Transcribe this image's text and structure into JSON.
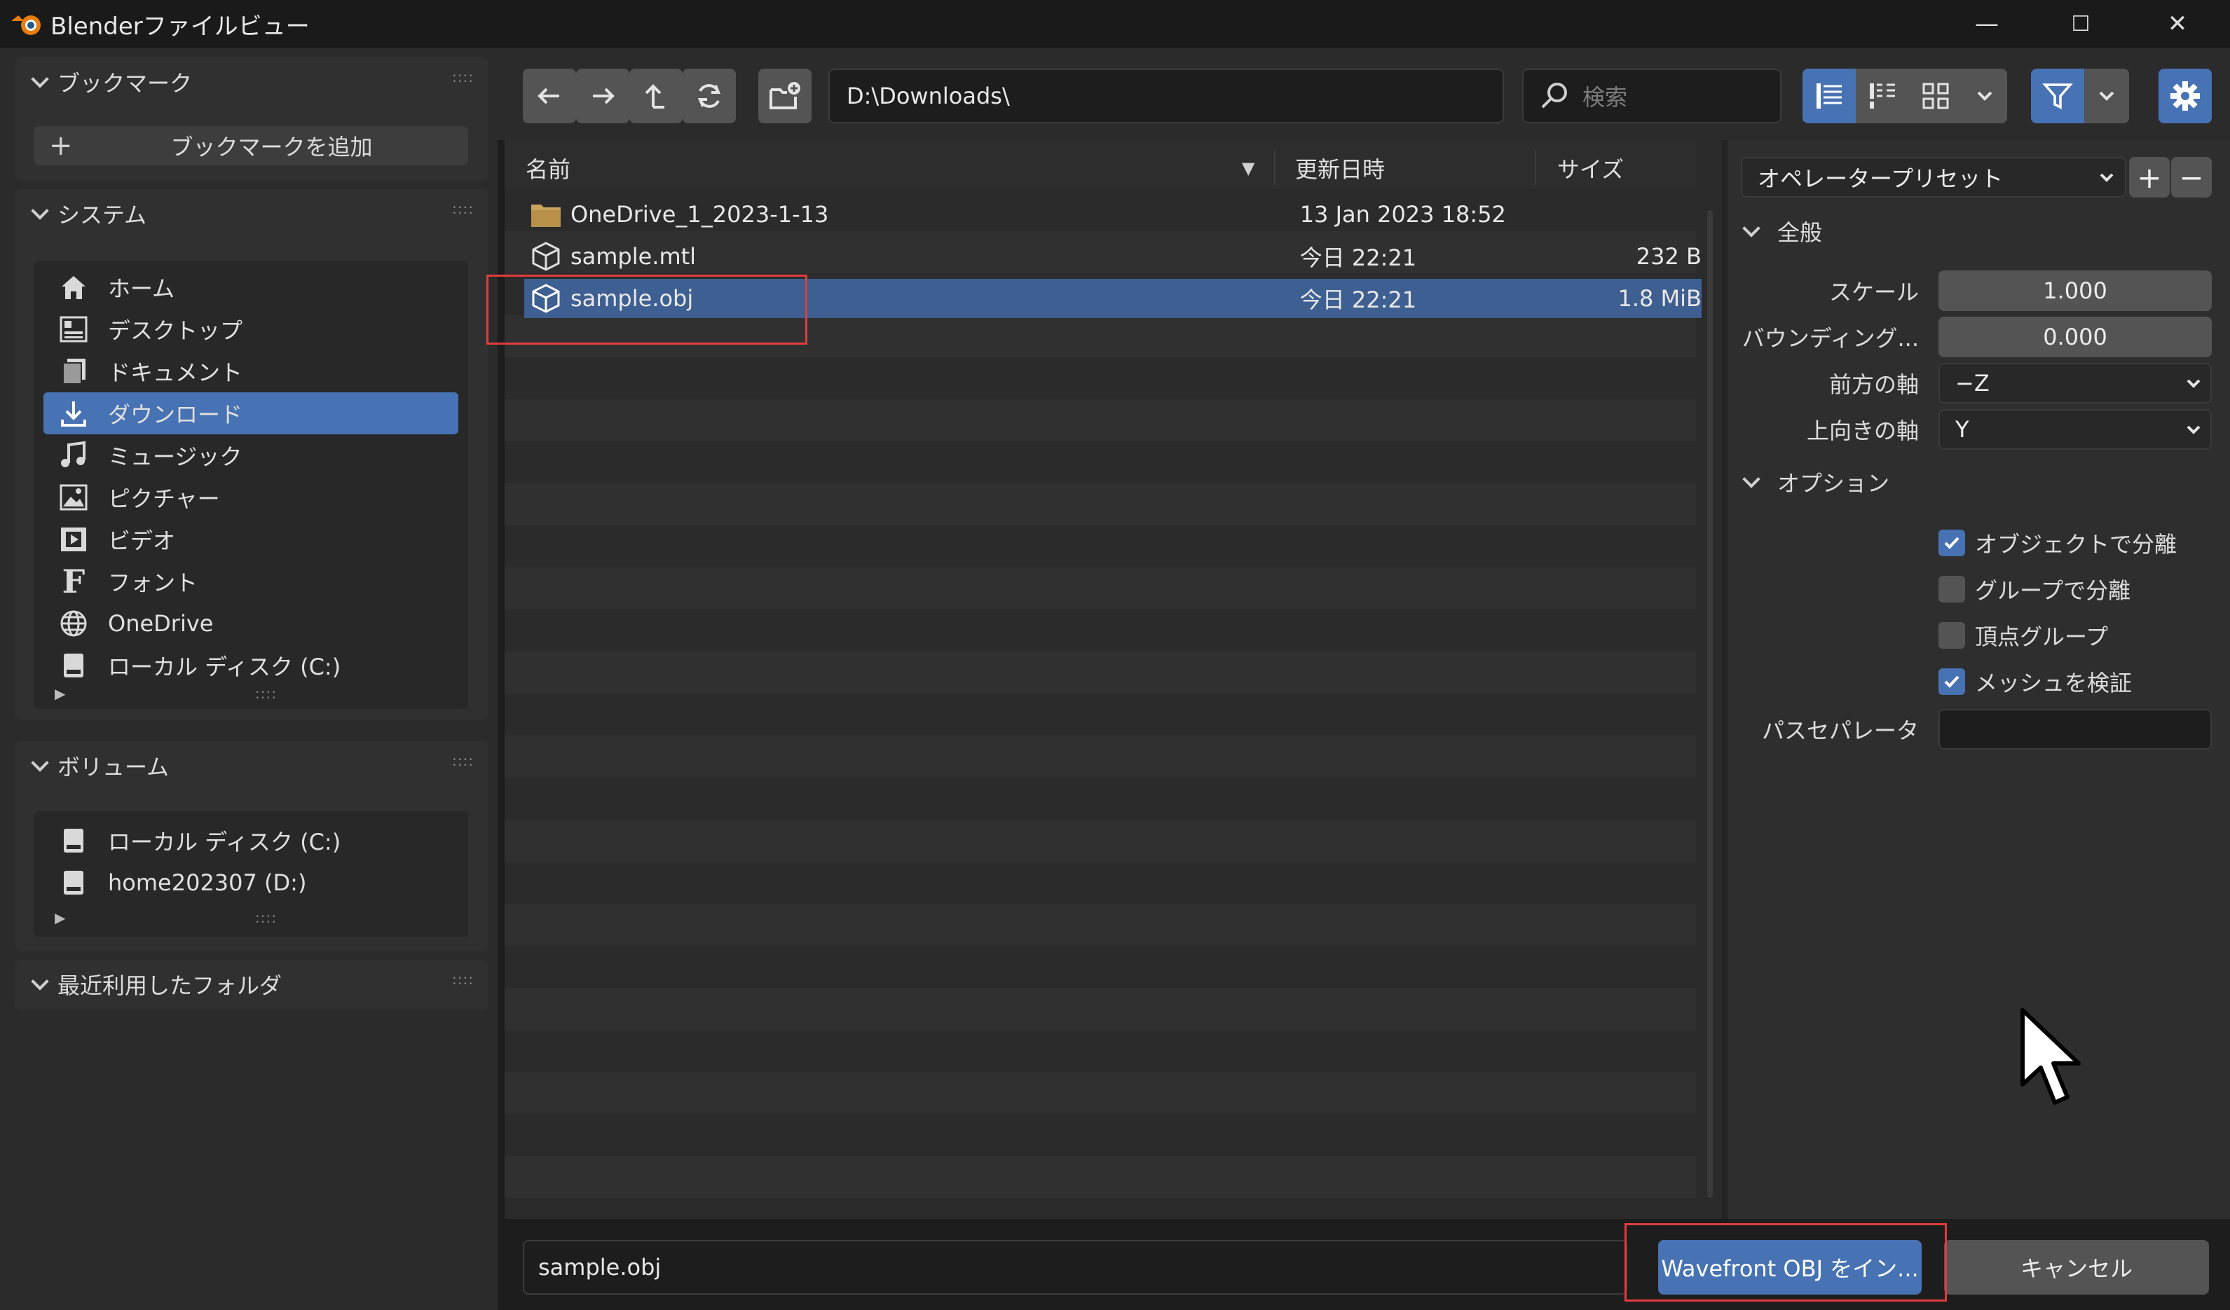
{
  "window": {
    "title": "Blenderファイルビュー",
    "minimize": "—",
    "maximize": "☐",
    "close": "✕"
  },
  "sidebar": {
    "bookmarks": {
      "title": "ブックマーク",
      "add_label": "ブックマークを追加"
    },
    "system": {
      "title": "システム",
      "items": [
        {
          "label": "ホーム",
          "icon": "home-icon"
        },
        {
          "label": "デスクトップ",
          "icon": "desktop-icon"
        },
        {
          "label": "ドキュメント",
          "icon": "documents-icon"
        },
        {
          "label": "ダウンロード",
          "icon": "download-icon",
          "selected": true
        },
        {
          "label": "ミュージック",
          "icon": "music-icon"
        },
        {
          "label": "ピクチャー",
          "icon": "picture-icon"
        },
        {
          "label": "ビデオ",
          "icon": "video-icon"
        },
        {
          "label": "フォント",
          "icon": "font-icon"
        },
        {
          "label": "OneDrive",
          "icon": "globe-icon"
        },
        {
          "label": "ローカル ディスク (C:)",
          "icon": "disk-icon"
        }
      ]
    },
    "volumes": {
      "title": "ボリューム",
      "items": [
        {
          "label": "ローカル ディスク (C:)",
          "icon": "disk-icon"
        },
        {
          "label": "home202307 (D:)",
          "icon": "disk-icon"
        }
      ]
    },
    "recent": {
      "title": "最近利用したフォルダ"
    }
  },
  "toolbar": {
    "path": "D:\\Downloads\\",
    "search_placeholder": "検索"
  },
  "filelist": {
    "columns": {
      "name": "名前",
      "modified": "更新日時",
      "size": "サイズ",
      "sort_indicator": "▼"
    },
    "rows": [
      {
        "name": "OneDrive_1_2023-1-13",
        "modified": "13 Jan 2023 18:52",
        "size": "",
        "type": "folder"
      },
      {
        "name": "sample.mtl",
        "modified": "今日 22:21",
        "size": "232 B",
        "type": "mesh"
      },
      {
        "name": "sample.obj",
        "modified": "今日 22:21",
        "size": "1.8 MiB",
        "type": "mesh",
        "selected": true
      }
    ]
  },
  "options": {
    "preset_label": "オペレータープリセット",
    "general": {
      "title": "全般",
      "scale_label": "スケール",
      "scale_value": "1.000",
      "bounding_label": "バウンディング...",
      "bounding_value": "0.000",
      "forward_label": "前方の軸",
      "forward_value": "−Z",
      "up_label": "上向きの軸",
      "up_value": "Y"
    },
    "options_section": {
      "title": "オプション",
      "checks": [
        {
          "label": "オブジェクトで分離",
          "checked": true
        },
        {
          "label": "グループで分離",
          "checked": false
        },
        {
          "label": "頂点グループ",
          "checked": false
        },
        {
          "label": "メッシュを検証",
          "checked": true
        }
      ],
      "separator_label": "パスセパレータ",
      "separator_value": ""
    }
  },
  "bottom": {
    "filename": "sample.obj",
    "import_label": "Wavefront OBJ をイン...",
    "cancel_label": "キャンセル"
  },
  "colors": {
    "accent": "#4772b3",
    "highlight": "#e03c3c",
    "folder": "#c9a45c"
  }
}
